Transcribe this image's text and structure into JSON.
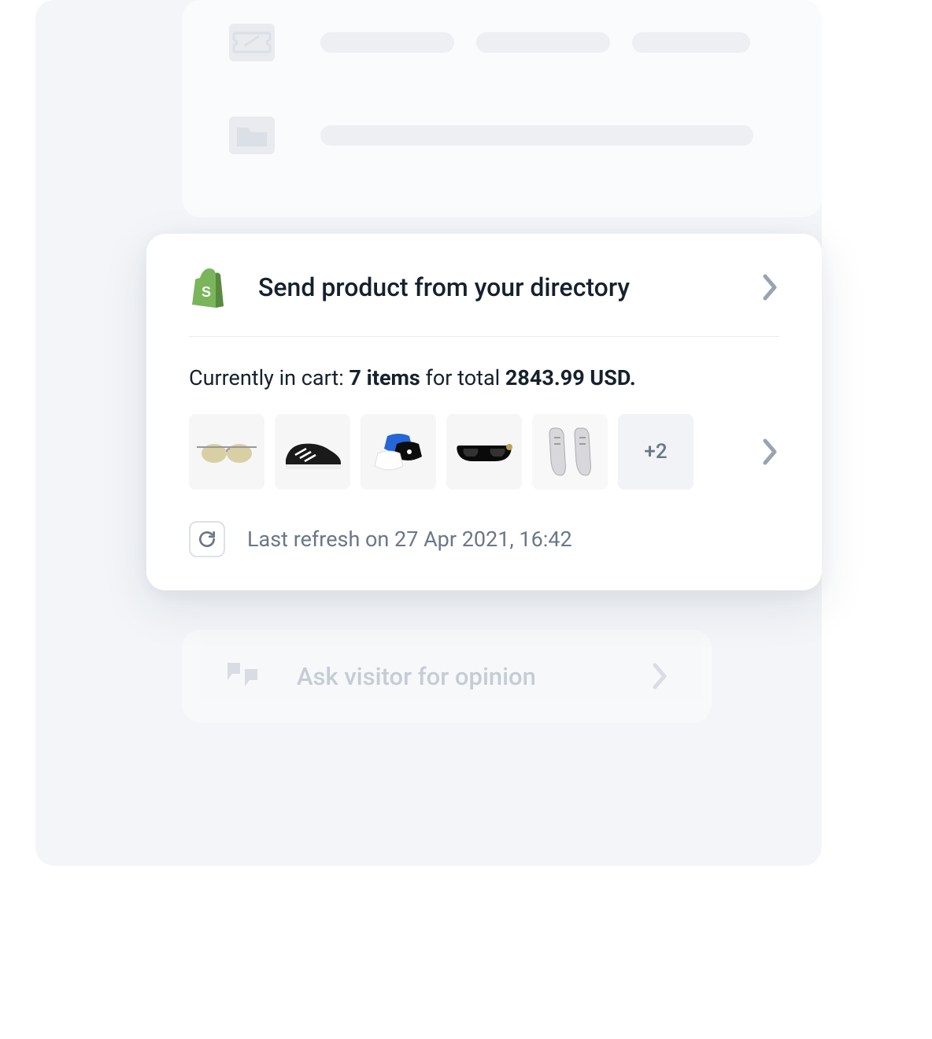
{
  "shopify_card": {
    "title": "Send product from your directory",
    "cart_label": "Currently in cart:",
    "cart_items_count": "7 items",
    "cart_for_total": "for total",
    "cart_total": "2843.99 USD.",
    "overflow_label": "+2",
    "refresh_label": "Last refresh on 27 Apr 2021, 16:42"
  },
  "opinion_card": {
    "title": "Ask visitor for opinion"
  },
  "products": [
    "sunglasses-aviator",
    "sneaker-black",
    "face-masks",
    "sunglasses-shield",
    "sneakers-silver"
  ],
  "colors": {
    "shopify_green": "#7ab55c",
    "text_dark": "#16212e",
    "text_muted": "#6a7788"
  }
}
